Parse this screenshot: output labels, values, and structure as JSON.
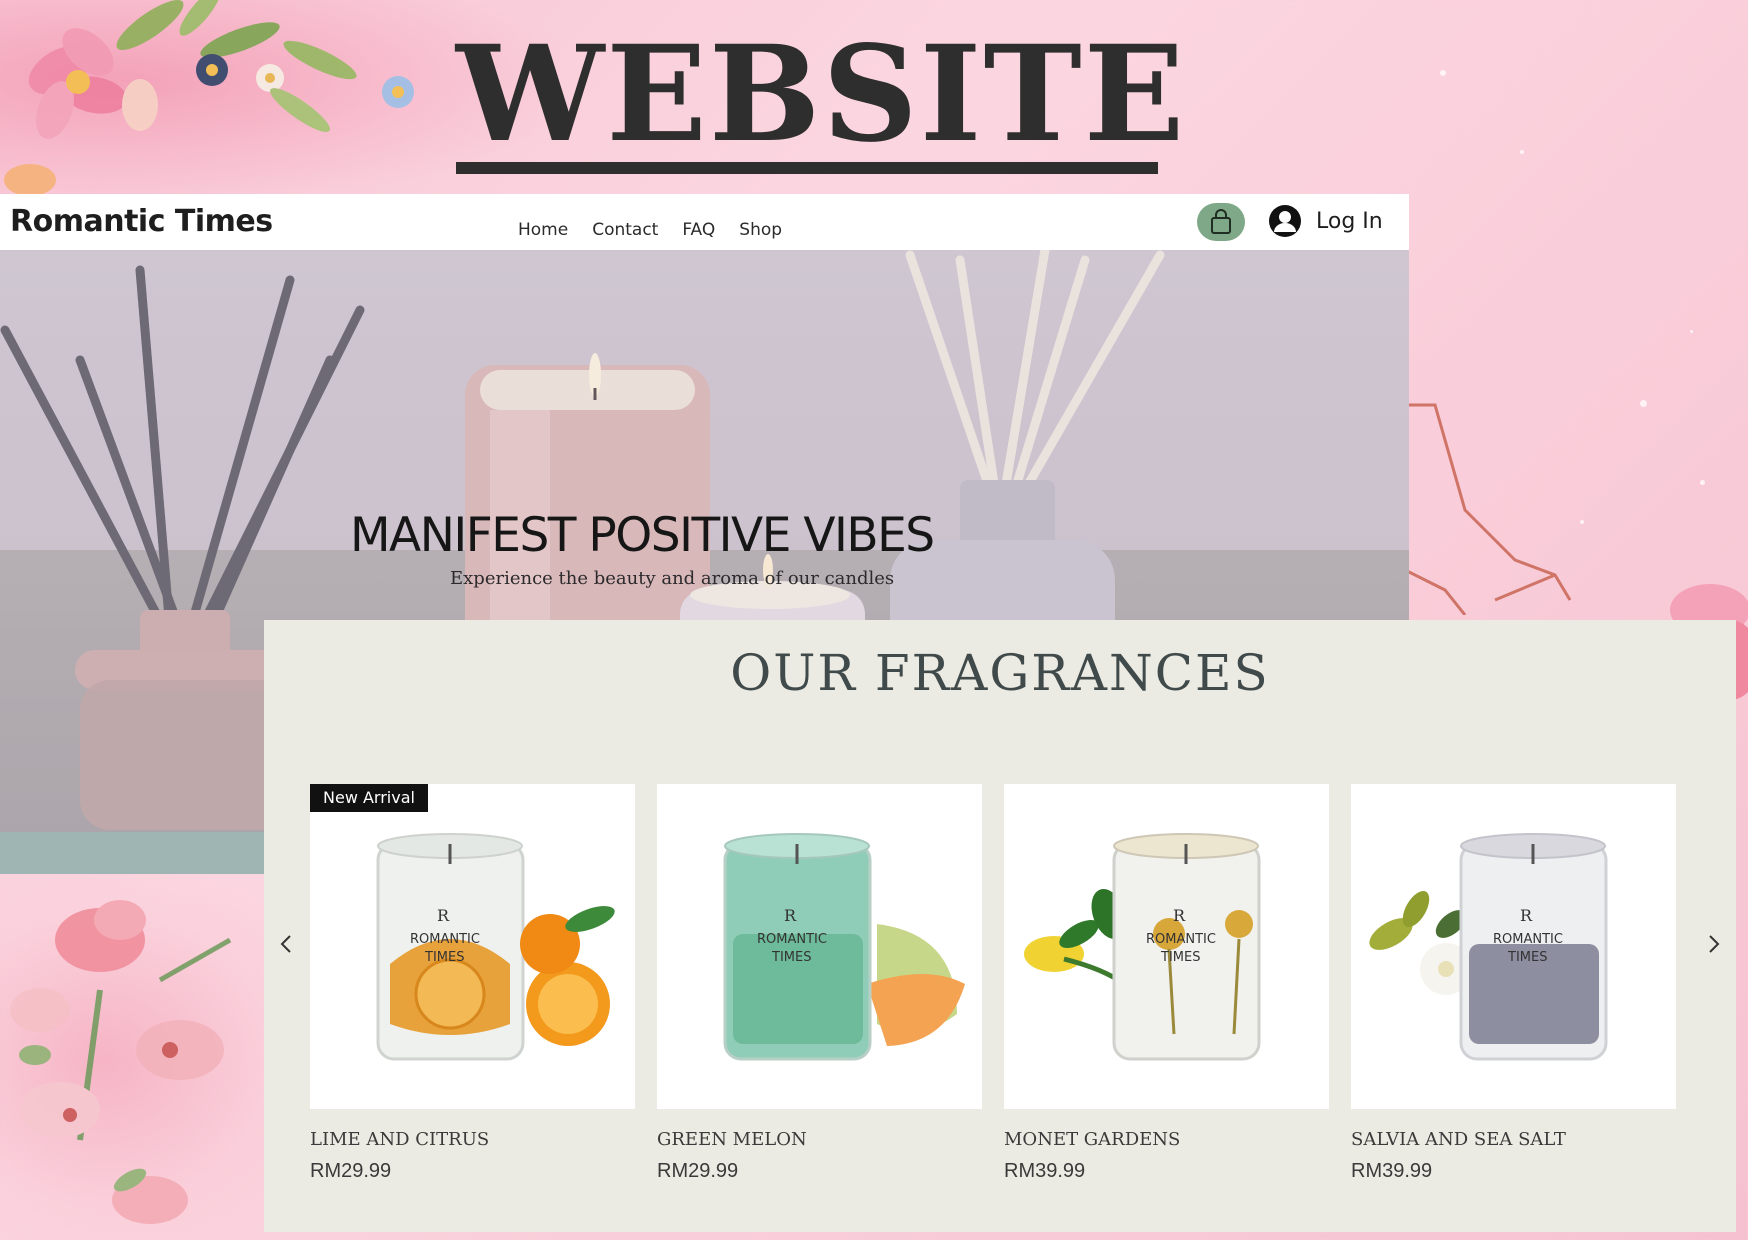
{
  "poster": {
    "heading": "WEBSITE"
  },
  "site": {
    "brand": "Romantic Times",
    "nav": [
      "Home",
      "Contact",
      "FAQ",
      "Shop"
    ],
    "login_label": "Log In",
    "icons": {
      "cart": "shopping-bag-icon",
      "account": "user-avatar-icon"
    },
    "colors": {
      "cart_button": "#7fa888",
      "ribbon": "#111111",
      "panel": "#ecebe3",
      "poster_bg": "#f9cdd9"
    }
  },
  "hero": {
    "title": "MANIFEST POSITIVE VIBES",
    "subtitle": "Experience the beauty and aroma of our candles"
  },
  "fragrances": {
    "title": "OUR FRAGRANCES",
    "products": [
      {
        "name": "LIME AND CITRUS",
        "price": "RM29.99",
        "badge": "New Arrival",
        "glass_label": [
          "R",
          "ROMANTIC",
          "TIMES"
        ],
        "accent": "orange"
      },
      {
        "name": "GREEN MELON",
        "price": "RM29.99",
        "badge": "",
        "glass_label": [
          "R",
          "ROMANTIC",
          "TIMES"
        ],
        "accent": "melon"
      },
      {
        "name": "MONET GARDENS",
        "price": "RM39.99",
        "badge": "",
        "glass_label": [
          "R",
          "ROMANTIC",
          "TIMES"
        ],
        "accent": "yellow-rose"
      },
      {
        "name": "SALVIA AND SEA SALT",
        "price": "RM39.99",
        "badge": "",
        "glass_label": [
          "R",
          "ROMANTIC",
          "TIMES"
        ],
        "accent": "white-flower"
      }
    ]
  }
}
